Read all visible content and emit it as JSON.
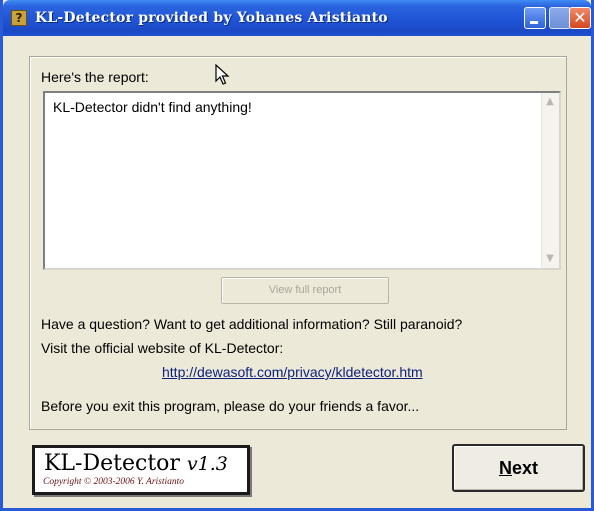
{
  "window": {
    "title": "KL-Detector provided by Yohanes Aristianto",
    "icon": "question-mark-app-icon",
    "controls": [
      "minimize",
      "maximize",
      "close"
    ]
  },
  "report": {
    "label": "Here's the report:",
    "content": "KL-Detector didn't find anything!",
    "view_full_report_label": "View full report",
    "view_full_report_enabled": false
  },
  "info": {
    "question_line": "Have a question? Want to get additional information? Still paranoid?",
    "visit_line": "Visit the official website of KL-Detector:",
    "url": "http://dewasoft.com/privacy/kldetector.htm",
    "favor_line": "Before you exit this program, please do your friends a favor..."
  },
  "logo": {
    "name": "KL-Detector",
    "version": "v1.3",
    "copyright": "Copyright © 2003-2006 Y. Aristianto"
  },
  "footer": {
    "next_label": "Next",
    "next_mnemonic": "N",
    "next_rest": "ext"
  },
  "colors": {
    "titlebar": "#1f55d6",
    "window_bg": "#ece9d8",
    "link": "#0b1f7a"
  }
}
